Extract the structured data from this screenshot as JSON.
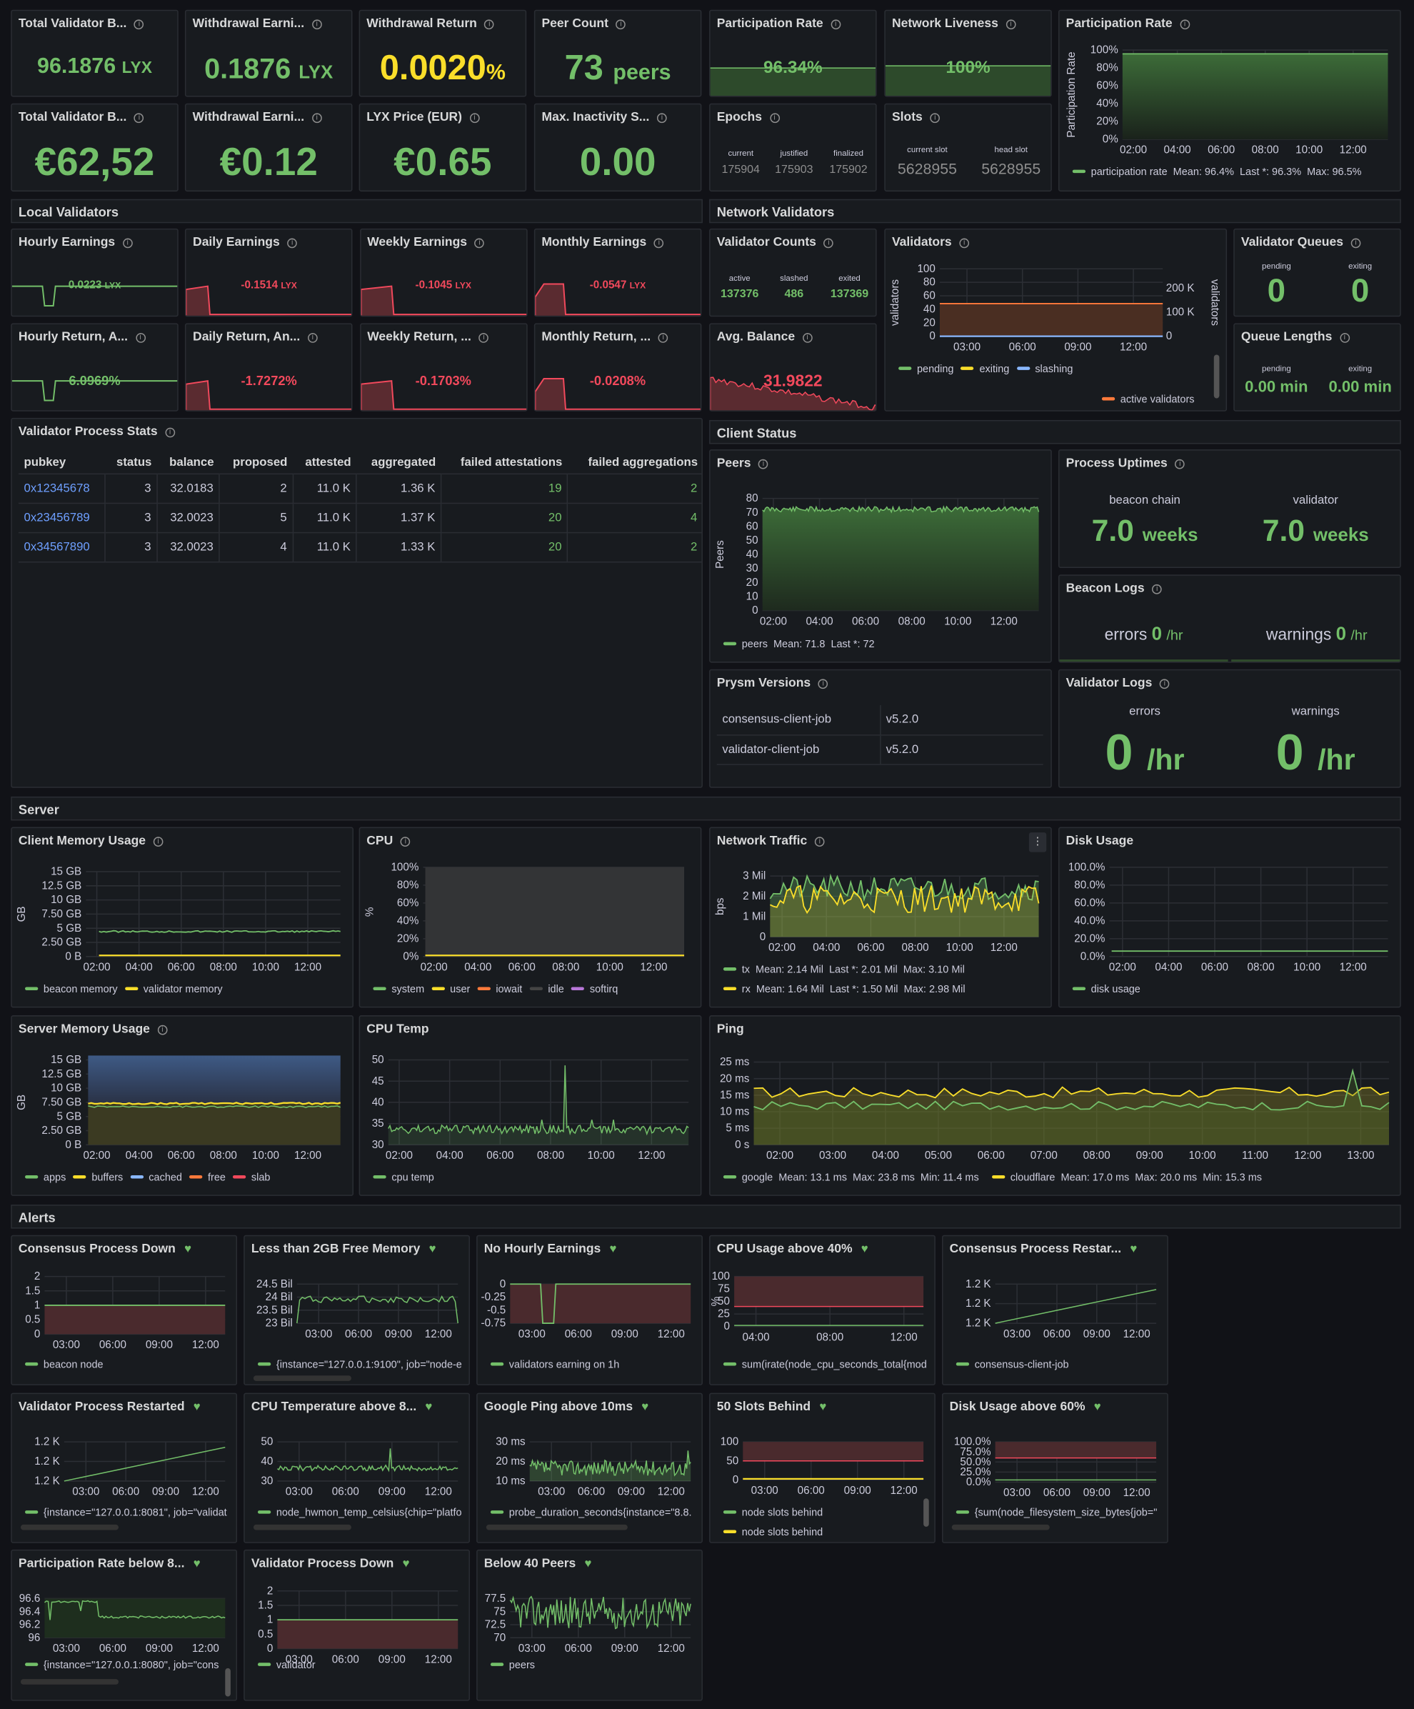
{
  "stats": {
    "total_validator_balance": {
      "title": "Total Validator B...",
      "value": "96.1876",
      "unit": "LYX"
    },
    "withdrawal_earnings": {
      "title": "Withdrawal Earni...",
      "value": "0.1876",
      "unit": "LYX"
    },
    "withdrawal_return": {
      "title": "Withdrawal Return",
      "value": "0.0020",
      "unit": "%"
    },
    "peer_count": {
      "title": "Peer Count",
      "value": "73",
      "unit": "peers"
    },
    "participation_rate": {
      "title": "Participation Rate",
      "value": "96.34%"
    },
    "network_liveness": {
      "title": "Network Liveness",
      "value": "100%"
    },
    "total_validator_balance_eur": {
      "title": "Total Validator B...",
      "value": "€62,52"
    },
    "withdrawal_earnings_eur": {
      "title": "Withdrawal Earni...",
      "value": "€0.12"
    },
    "lyx_price": {
      "title": "LYX Price (EUR)",
      "value": "€0.65"
    },
    "max_inactivity": {
      "title": "Max. Inactivity S...",
      "value": "0.00"
    },
    "epochs": {
      "title": "Epochs",
      "labels": [
        "current",
        "justified",
        "finalized"
      ],
      "values": [
        "175904",
        "175903",
        "175902"
      ]
    },
    "slots": {
      "title": "Slots",
      "labels": [
        "current slot",
        "head slot"
      ],
      "values": [
        "5628955",
        "5628955"
      ]
    }
  },
  "participation_chart": {
    "title": "Participation Rate",
    "ylabel": "Participation Rate",
    "yticks": [
      "100%",
      "80%",
      "60%",
      "40%",
      "20%",
      "0%"
    ],
    "xticks": [
      "02:00",
      "04:00",
      "06:00",
      "08:00",
      "10:00",
      "12:00"
    ],
    "legend": "participation rate",
    "mean": "Mean: 96.4%",
    "last": "Last *: 96.3%",
    "max": "Max: 96.5%"
  },
  "rows": {
    "local": "Local Validators",
    "network": "Network Validators",
    "server": "Server",
    "alerts": "Alerts",
    "client_status": "Client Status"
  },
  "earnings": [
    {
      "title": "Hourly Earnings",
      "value": "0.0223",
      "unit": "LYX"
    },
    {
      "title": "Daily Earnings",
      "value": "-0.1514",
      "unit": "LYX"
    },
    {
      "title": "Weekly Earnings",
      "value": "-0.1045",
      "unit": "LYX"
    },
    {
      "title": "Monthly Earnings",
      "value": "-0.0547",
      "unit": "LYX"
    }
  ],
  "returns": [
    {
      "title": "Hourly Return, A...",
      "value": "6.0969%"
    },
    {
      "title": "Daily Return, An...",
      "value": "-1.7272%"
    },
    {
      "title": "Weekly Return, ...",
      "value": "-0.1703%"
    },
    {
      "title": "Monthly Return, ...",
      "value": "-0.0208%"
    }
  ],
  "validator_counts": {
    "title": "Validator Counts",
    "labels": [
      "active",
      "slashed",
      "exited"
    ],
    "values": [
      "137376",
      "486",
      "137369"
    ]
  },
  "avg_balance": {
    "title": "Avg. Balance",
    "value": "31.9822"
  },
  "validators_chart": {
    "title": "Validators",
    "ylabel": "validators",
    "ylabel_right": "validators",
    "yticks": [
      "100",
      "80",
      "60",
      "40",
      "20",
      "0"
    ],
    "yticks_right": [
      "200 K",
      "100 K",
      "0"
    ],
    "xticks": [
      "03:00",
      "06:00",
      "09:00",
      "12:00"
    ],
    "legend": [
      "pending",
      "exiting",
      "slashing",
      "active validators"
    ]
  },
  "validator_queues": {
    "title": "Validator Queues",
    "labels": [
      "pending",
      "exiting"
    ],
    "values": [
      "0",
      "0"
    ]
  },
  "queue_lengths": {
    "title": "Queue Lengths",
    "labels": [
      "pending",
      "exiting"
    ],
    "values": [
      "0.00 min",
      "0.00 min"
    ]
  },
  "process_stats": {
    "title": "Validator Process Stats",
    "headers": [
      "pubkey",
      "status",
      "balance",
      "proposed",
      "attested",
      "aggregated",
      "failed attestations",
      "failed aggregations"
    ],
    "rows": [
      [
        "0x12345678",
        "3",
        "32.0183",
        "2",
        "11.0 K",
        "1.36 K",
        "19",
        "2"
      ],
      [
        "0x23456789",
        "3",
        "32.0023",
        "5",
        "11.0 K",
        "1.37 K",
        "20",
        "4"
      ],
      [
        "0x34567890",
        "3",
        "32.0023",
        "4",
        "11.0 K",
        "1.33 K",
        "20",
        "2"
      ]
    ]
  },
  "peers_chart": {
    "title": "Peers",
    "ylabel": "Peers",
    "yticks": [
      "80",
      "70",
      "60",
      "50",
      "40",
      "30",
      "20",
      "10",
      "0"
    ],
    "xticks": [
      "02:00",
      "04:00",
      "06:00",
      "08:00",
      "10:00",
      "12:00"
    ],
    "legend": "peers",
    "mean": "Mean: 71.8",
    "last": "Last *: 72"
  },
  "uptimes": {
    "title": "Process Uptimes",
    "labels": [
      "beacon chain",
      "validator"
    ],
    "values": [
      "7.0",
      "7.0"
    ],
    "unit": "weeks"
  },
  "beacon_logs": {
    "title": "Beacon Logs",
    "errors_label": "errors",
    "errors": "0",
    "warnings_label": "warnings",
    "warnings": "0",
    "unit": "/hr"
  },
  "prysm": {
    "title": "Prysm Versions",
    "rows": [
      [
        "consensus-client-job",
        "v5.2.0"
      ],
      [
        "validator-client-job",
        "v5.2.0"
      ]
    ]
  },
  "validator_logs": {
    "title": "Validator Logs",
    "labels": [
      "errors",
      "warnings"
    ],
    "values": [
      "0",
      "0"
    ],
    "unit": "/hr"
  },
  "client_memory": {
    "title": "Client Memory Usage",
    "ylabel": "GB",
    "yticks": [
      "15 GB",
      "12.5 GB",
      "10 GB",
      "7.50 GB",
      "5 GB",
      "2.50 GB",
      "0 B"
    ],
    "xticks": [
      "02:00",
      "04:00",
      "06:00",
      "08:00",
      "10:00",
      "12:00"
    ],
    "legend": [
      "beacon memory",
      "validator memory"
    ]
  },
  "cpu": {
    "title": "CPU",
    "ylabel": "%",
    "yticks": [
      "100%",
      "80%",
      "60%",
      "40%",
      "20%",
      "0%"
    ],
    "xticks": [
      "02:00",
      "04:00",
      "06:00",
      "08:00",
      "10:00",
      "12:00"
    ],
    "legend": [
      "system",
      "user",
      "iowait",
      "idle",
      "softirq"
    ]
  },
  "network_traffic": {
    "title": "Network Traffic",
    "ylabel": "bps",
    "yticks": [
      "3 Mil",
      "2 Mil",
      "1 Mil",
      "0"
    ],
    "xticks": [
      "02:00",
      "04:00",
      "06:00",
      "08:00",
      "10:00",
      "12:00"
    ],
    "legend": [
      [
        "tx",
        "Mean: 2.14 Mil",
        "Last *: 2.01 Mil",
        "Max: 3.10 Mil"
      ],
      [
        "rx",
        "Mean: 1.64 Mil",
        "Last *: 1.50 Mil",
        "Max: 2.98 Mil"
      ]
    ]
  },
  "disk_usage": {
    "title": "Disk Usage",
    "yticks": [
      "100.0%",
      "80.0%",
      "60.0%",
      "40.0%",
      "20.0%",
      "0.0%"
    ],
    "xticks": [
      "02:00",
      "04:00",
      "06:00",
      "08:00",
      "10:00",
      "12:00"
    ],
    "legend": "disk usage"
  },
  "server_memory": {
    "title": "Server Memory Usage",
    "ylabel": "GB",
    "yticks": [
      "15 GB",
      "12.5 GB",
      "10 GB",
      "7.50 GB",
      "5 GB",
      "2.50 GB",
      "0 B"
    ],
    "xticks": [
      "02:00",
      "04:00",
      "06:00",
      "08:00",
      "10:00",
      "12:00"
    ],
    "legend": [
      "apps",
      "buffers",
      "cached",
      "free",
      "slab"
    ]
  },
  "cpu_temp": {
    "title": "CPU Temp",
    "yticks": [
      "50",
      "45",
      "40",
      "35",
      "30"
    ],
    "xticks": [
      "02:00",
      "04:00",
      "06:00",
      "08:00",
      "10:00",
      "12:00"
    ],
    "legend": "cpu temp"
  },
  "ping": {
    "title": "Ping",
    "yticks": [
      "25 ms",
      "20 ms",
      "15 ms",
      "10 ms",
      "5 ms",
      "0 s"
    ],
    "xticks": [
      "02:00",
      "03:00",
      "04:00",
      "05:00",
      "06:00",
      "07:00",
      "08:00",
      "09:00",
      "10:00",
      "11:00",
      "12:00",
      "13:00"
    ],
    "legend": [
      [
        "google",
        "Mean: 13.1 ms",
        "Max: 23.8 ms",
        "Min: 11.4 ms"
      ],
      [
        "cloudflare",
        "Mean: 17.0 ms",
        "Max: 20.0 ms",
        "Min: 15.3 ms"
      ]
    ]
  },
  "alerts": [
    {
      "title": "Consensus Process Down",
      "yticks": [
        "2",
        "1.5",
        "1",
        "0.5",
        "0"
      ],
      "xticks": [
        "03:00",
        "06:00",
        "09:00",
        "12:00"
      ],
      "legend": "beacon node"
    },
    {
      "title": "Less than 2GB Free Memory",
      "yticks": [
        "24.5 Bil",
        "24 Bil",
        "23.5 Bil",
        "23 Bil"
      ],
      "xticks": [
        "03:00",
        "06:00",
        "09:00",
        "12:00"
      ],
      "legend": "{instance=\"127.0.0.1:9100\", job=\"node-e"
    },
    {
      "title": "No Hourly Earnings",
      "yticks": [
        "0",
        "-0.25",
        "-0.5",
        "-0.75"
      ],
      "xticks": [
        "03:00",
        "06:00",
        "09:00",
        "12:00"
      ],
      "legend": "validators earning on 1h"
    },
    {
      "title": "CPU Usage above 40%",
      "ylabel": "%",
      "yticks": [
        "100",
        "75",
        "50",
        "25",
        "0"
      ],
      "xticks": [
        "04:00",
        "08:00",
        "12:00"
      ],
      "legend": "sum(irate(node_cpu_seconds_total{mod"
    },
    {
      "title": "Consensus Process Restar...",
      "yticks": [
        "1.2 K",
        "1.2 K",
        "1.2 K"
      ],
      "xticks": [
        "03:00",
        "06:00",
        "09:00",
        "12:00"
      ],
      "legend": "consensus-client-job"
    },
    {
      "title": "Validator Process Restarted",
      "yticks": [
        "1.2 K",
        "1.2 K",
        "1.2 K"
      ],
      "xticks": [
        "03:00",
        "06:00",
        "09:00",
        "12:00"
      ],
      "legend": "{instance=\"127.0.0.1:8081\", job=\"validat"
    },
    {
      "title": "CPU Temperature above 8...",
      "yticks": [
        "50",
        "40",
        "30"
      ],
      "xticks": [
        "03:00",
        "06:00",
        "09:00",
        "12:00"
      ],
      "legend": "node_hwmon_temp_celsius{chip=\"platfo"
    },
    {
      "title": "Google Ping above 10ms",
      "yticks": [
        "30 ms",
        "20 ms",
        "10 ms"
      ],
      "xticks": [
        "03:00",
        "06:00",
        "09:00",
        "12:00"
      ],
      "legend": "probe_duration_seconds{instance=\"8.8."
    },
    {
      "title": "50 Slots Behind",
      "yticks": [
        "100",
        "50",
        "0"
      ],
      "xticks": [
        "03:00",
        "06:00",
        "09:00",
        "12:00"
      ],
      "legend": "node slots behind",
      "legend2": "node slots behind"
    },
    {
      "title": "Disk Usage above 60%",
      "yticks": [
        "100.0%",
        "75.0%",
        "50.0%",
        "25.0%",
        "0.0%"
      ],
      "xticks": [
        "03:00",
        "06:00",
        "09:00",
        "12:00"
      ],
      "legend": "{sum(node_filesystem_size_bytes{job=\""
    },
    {
      "title": "Participation Rate below 8...",
      "yticks": [
        "96.6",
        "96.4",
        "96.2",
        "96"
      ],
      "xticks": [
        "03:00",
        "06:00",
        "09:00",
        "12:00"
      ],
      "legend": "{instance=\"127.0.0.1:8080\", job=\"cons"
    },
    {
      "title": "Validator Process Down",
      "yticks": [
        "2",
        "1.5",
        "1",
        "0.5",
        "0"
      ],
      "xticks": [
        "03:00",
        "06:00",
        "09:00",
        "12:00"
      ],
      "legend": "validator"
    },
    {
      "title": "Below 40 Peers",
      "yticks": [
        "77.5",
        "75",
        "72.5",
        "70"
      ],
      "xticks": [
        "03:00",
        "06:00",
        "09:00",
        "12:00"
      ],
      "legend": "peers"
    }
  ],
  "colors": {
    "green": "#73bf69",
    "yellow": "#fade2a",
    "red": "#f2495c",
    "blue": "#6e9fff",
    "orange": "#ff9830",
    "purple": "#b877d9",
    "bg": "#111217",
    "panel": "#181b1f"
  }
}
